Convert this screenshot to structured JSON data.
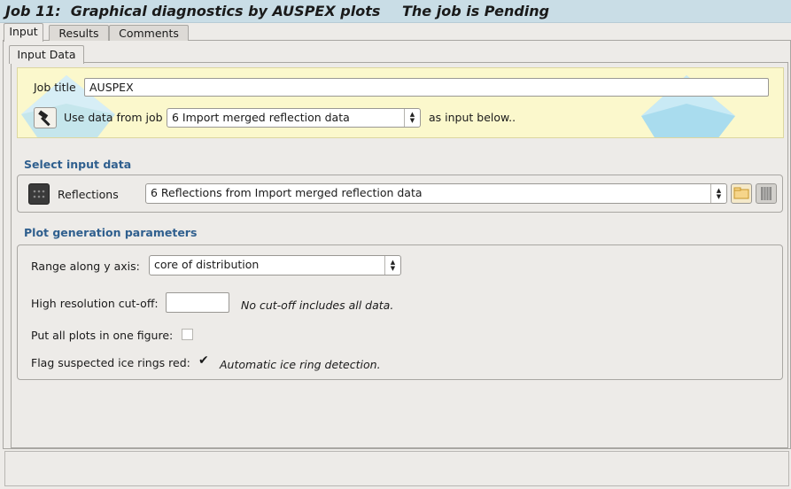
{
  "window": {
    "title": "Job 11:  Graphical diagnostics by AUSPEX plots",
    "status": "The job is Pending"
  },
  "tabs": [
    {
      "label": "Input",
      "active": true
    },
    {
      "label": "Results",
      "active": false
    },
    {
      "label": "Comments",
      "active": false
    }
  ],
  "subtab": {
    "label": "Input Data"
  },
  "header": {
    "job_title_label": "Job title",
    "job_title_value": "AUSPEX",
    "use_data_label": "Use data from job",
    "use_data_value": "6 Import merged reflection data",
    "as_input_label": "as input below.."
  },
  "input_section": {
    "title": "Select input data",
    "reflections_label": "Reflections",
    "reflections_value": "6 Reflections from Import merged reflection data"
  },
  "params_section": {
    "title": "Plot generation parameters",
    "range_label": "Range along y axis:",
    "range_value": "core of distribution",
    "high_res_label": "High resolution cut-off:",
    "high_res_value": "",
    "high_res_note": "No cut-off includes all data.",
    "one_figure_label": "Put all plots in one figure:",
    "one_figure_checked": false,
    "ice_rings_label": "Flag suspected ice rings red:",
    "ice_rings_checked": true,
    "ice_rings_note": "Automatic ice ring detection."
  },
  "icons": {
    "hammer": "hammer-icon",
    "reflections": "reflections-data-icon",
    "folder": "folder-icon",
    "database": "database-icon"
  },
  "colors": {
    "title_bar": "#c9dde6",
    "yellow_panel": "#fbf8cc",
    "section_title": "#2f5f8e"
  }
}
